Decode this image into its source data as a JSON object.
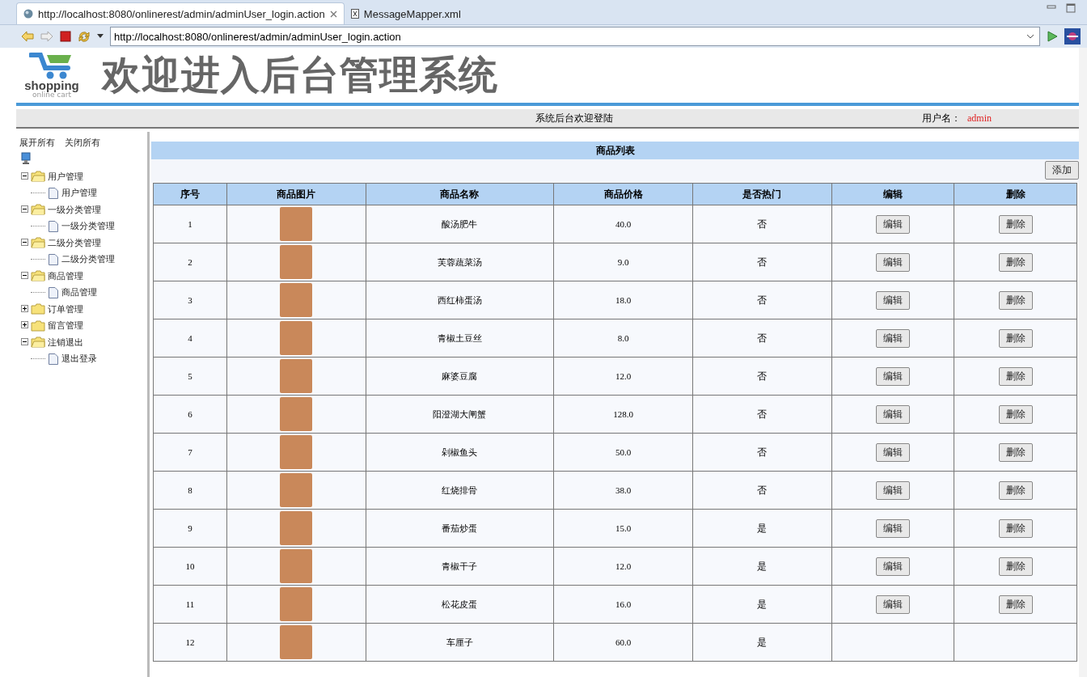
{
  "editor_tabs": [
    {
      "label": "http://localhost:8080/onlinerest/admin/adminUser_login.action",
      "kind": "web",
      "selected": true
    },
    {
      "label": "MessageMapper.xml",
      "kind": "xml",
      "selected": false
    }
  ],
  "address_bar": {
    "value": "http://localhost:8080/onlinerest/admin/adminUser_login.action"
  },
  "header": {
    "logo_text": "shopping",
    "logo_subtext": "online cart",
    "title": "欢迎进入后台管理系统"
  },
  "status_strip": {
    "welcome": "系统后台欢迎登陆",
    "user_label": "用户名：",
    "user_name": "admin"
  },
  "sidebar": {
    "expand_all": "展开所有",
    "collapse_all": "关闭所有",
    "tree": [
      {
        "label": "用户管理",
        "expanded": true,
        "children": [
          {
            "label": "用户管理"
          }
        ]
      },
      {
        "label": "一级分类管理",
        "expanded": true,
        "children": [
          {
            "label": "一级分类管理"
          }
        ]
      },
      {
        "label": "二级分类管理",
        "expanded": true,
        "children": [
          {
            "label": "二级分类管理"
          }
        ]
      },
      {
        "label": "商品管理",
        "expanded": true,
        "children": [
          {
            "label": "商品管理"
          }
        ]
      },
      {
        "label": "订单管理",
        "expanded": false
      },
      {
        "label": "留言管理",
        "expanded": false
      },
      {
        "label": "注销退出",
        "expanded": true,
        "children": [
          {
            "label": "退出登录"
          }
        ]
      }
    ]
  },
  "panel": {
    "title": "商品列表",
    "add_button": "添加"
  },
  "table": {
    "columns": [
      "序号",
      "商品图片",
      "商品名称",
      "商品价格",
      "是否热门",
      "编辑",
      "删除"
    ],
    "rows": [
      {
        "no": "1",
        "name": "酸汤肥牛",
        "price": "40.0",
        "hot": "否",
        "edit": "编辑",
        "delete": "删除"
      },
      {
        "no": "2",
        "name": "芙蓉蔬菜汤",
        "price": "9.0",
        "hot": "否",
        "edit": "编辑",
        "delete": "删除"
      },
      {
        "no": "3",
        "name": "西红柿蛋汤",
        "price": "18.0",
        "hot": "否",
        "edit": "编辑",
        "delete": "删除"
      },
      {
        "no": "4",
        "name": "青椒土豆丝",
        "price": "8.0",
        "hot": "否",
        "edit": "编辑",
        "delete": "删除"
      },
      {
        "no": "5",
        "name": "麻婆豆腐",
        "price": "12.0",
        "hot": "否",
        "edit": "编辑",
        "delete": "删除"
      },
      {
        "no": "6",
        "name": "阳澄湖大闸蟹",
        "price": "128.0",
        "hot": "否",
        "edit": "编辑",
        "delete": "删除"
      },
      {
        "no": "7",
        "name": "剁椒鱼头",
        "price": "50.0",
        "hot": "否",
        "edit": "编辑",
        "delete": "删除"
      },
      {
        "no": "8",
        "name": "红烧排骨",
        "price": "38.0",
        "hot": "否",
        "edit": "编辑",
        "delete": "删除"
      },
      {
        "no": "9",
        "name": "番茄炒蛋",
        "price": "15.0",
        "hot": "是",
        "edit": "编辑",
        "delete": "删除"
      },
      {
        "no": "10",
        "name": "青椒干子",
        "price": "12.0",
        "hot": "是",
        "edit": "编辑",
        "delete": "删除"
      },
      {
        "no": "11",
        "name": "松花皮蛋",
        "price": "16.0",
        "hot": "是",
        "edit": "编辑",
        "delete": "删除"
      },
      {
        "no": "12",
        "name": "车厘子",
        "price": "60.0",
        "hot": "是"
      }
    ]
  }
}
